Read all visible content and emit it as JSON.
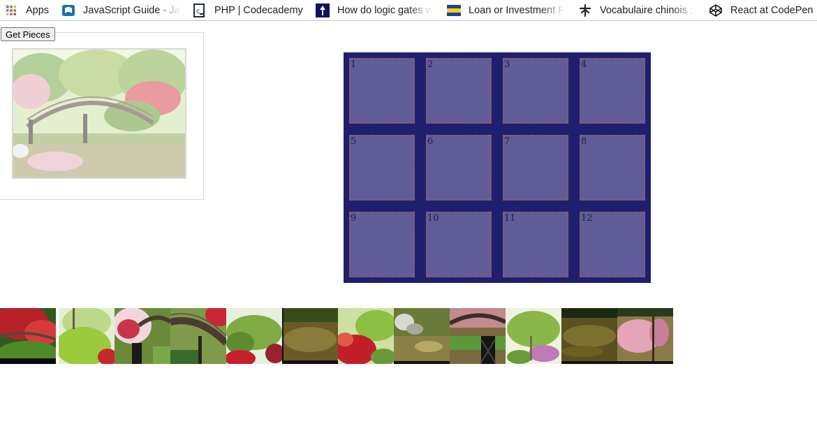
{
  "bookmarks": [
    {
      "label": "Apps",
      "icon": "apps-grid-icon"
    },
    {
      "label": "JavaScript Guide - Ja",
      "icon": "mdn-icon"
    },
    {
      "label": "PHP | Codecademy",
      "icon": "codecademy-icon"
    },
    {
      "label": "How do logic gates w",
      "icon": "logic-gates-icon"
    },
    {
      "label": "Loan or Investment F",
      "icon": "flag-icon"
    },
    {
      "label": "Vocabulaire chinois :",
      "icon": "chinese-char-icon"
    },
    {
      "label": "React at CodePen",
      "icon": "codepen-icon"
    }
  ],
  "controls": {
    "get_pieces_label": "Get Pieces"
  },
  "board": {
    "cells": [
      "1",
      "2",
      "3",
      "4",
      "5",
      "6",
      "7",
      "8",
      "9",
      "10",
      "11",
      "12"
    ],
    "colors": {
      "frame": "#1f1f6e",
      "cell": "#5f5c98",
      "border": "#8a5a6e"
    }
  },
  "pieces": [
    {
      "icon": "puzzle-piece-red-maple"
    },
    {
      "icon": "puzzle-piece-green-shrubs"
    },
    {
      "icon": "puzzle-piece-pink-tree-bridge"
    },
    {
      "icon": "puzzle-piece-bridge-arch"
    },
    {
      "icon": "puzzle-piece-green-trees"
    },
    {
      "icon": "puzzle-piece-pond-reflection"
    },
    {
      "icon": "puzzle-piece-red-bush"
    },
    {
      "icon": "puzzle-piece-rocks-water"
    },
    {
      "icon": "puzzle-piece-bridge-reflection"
    },
    {
      "icon": "puzzle-piece-purple-flowers"
    },
    {
      "icon": "puzzle-piece-dark-water"
    },
    {
      "icon": "puzzle-piece-pink-water"
    }
  ]
}
